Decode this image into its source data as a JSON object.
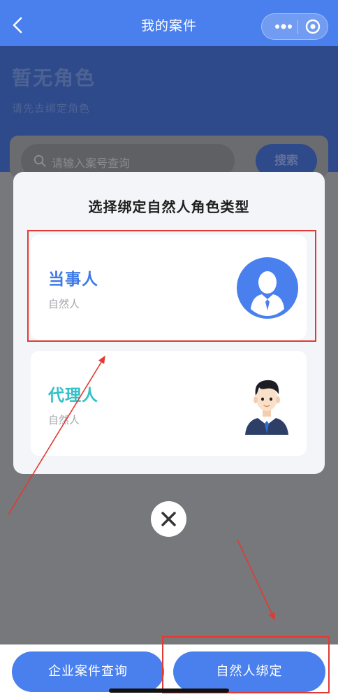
{
  "navbar": {
    "title": "我的案件",
    "back_icon": "chevron-left-icon",
    "more_icon": "more-dots-icon",
    "target_icon": "circle-target-icon",
    "background": "#4a80ee"
  },
  "header": {
    "role_title": "暂无角色",
    "role_subtitle": "请先去绑定角色"
  },
  "search": {
    "placeholder": "请输入案号查询",
    "button_label": "搜索",
    "icon": "search-icon"
  },
  "modal": {
    "title": "选择绑定自然人角色类型",
    "options": [
      {
        "name": "当事人",
        "kind": "自然人",
        "color": "#3f7ae8",
        "icon": "person-circle-icon"
      },
      {
        "name": "代理人",
        "kind": "自然人",
        "color": "#2fc0c8",
        "icon": "agent-avatar-icon"
      }
    ],
    "close_icon": "close-icon"
  },
  "bottom_bar": {
    "company_query_label": "企业案件查询",
    "natural_person_bind_label": "自然人绑定"
  },
  "annotations": {
    "highlight_color": "#e23a33"
  }
}
